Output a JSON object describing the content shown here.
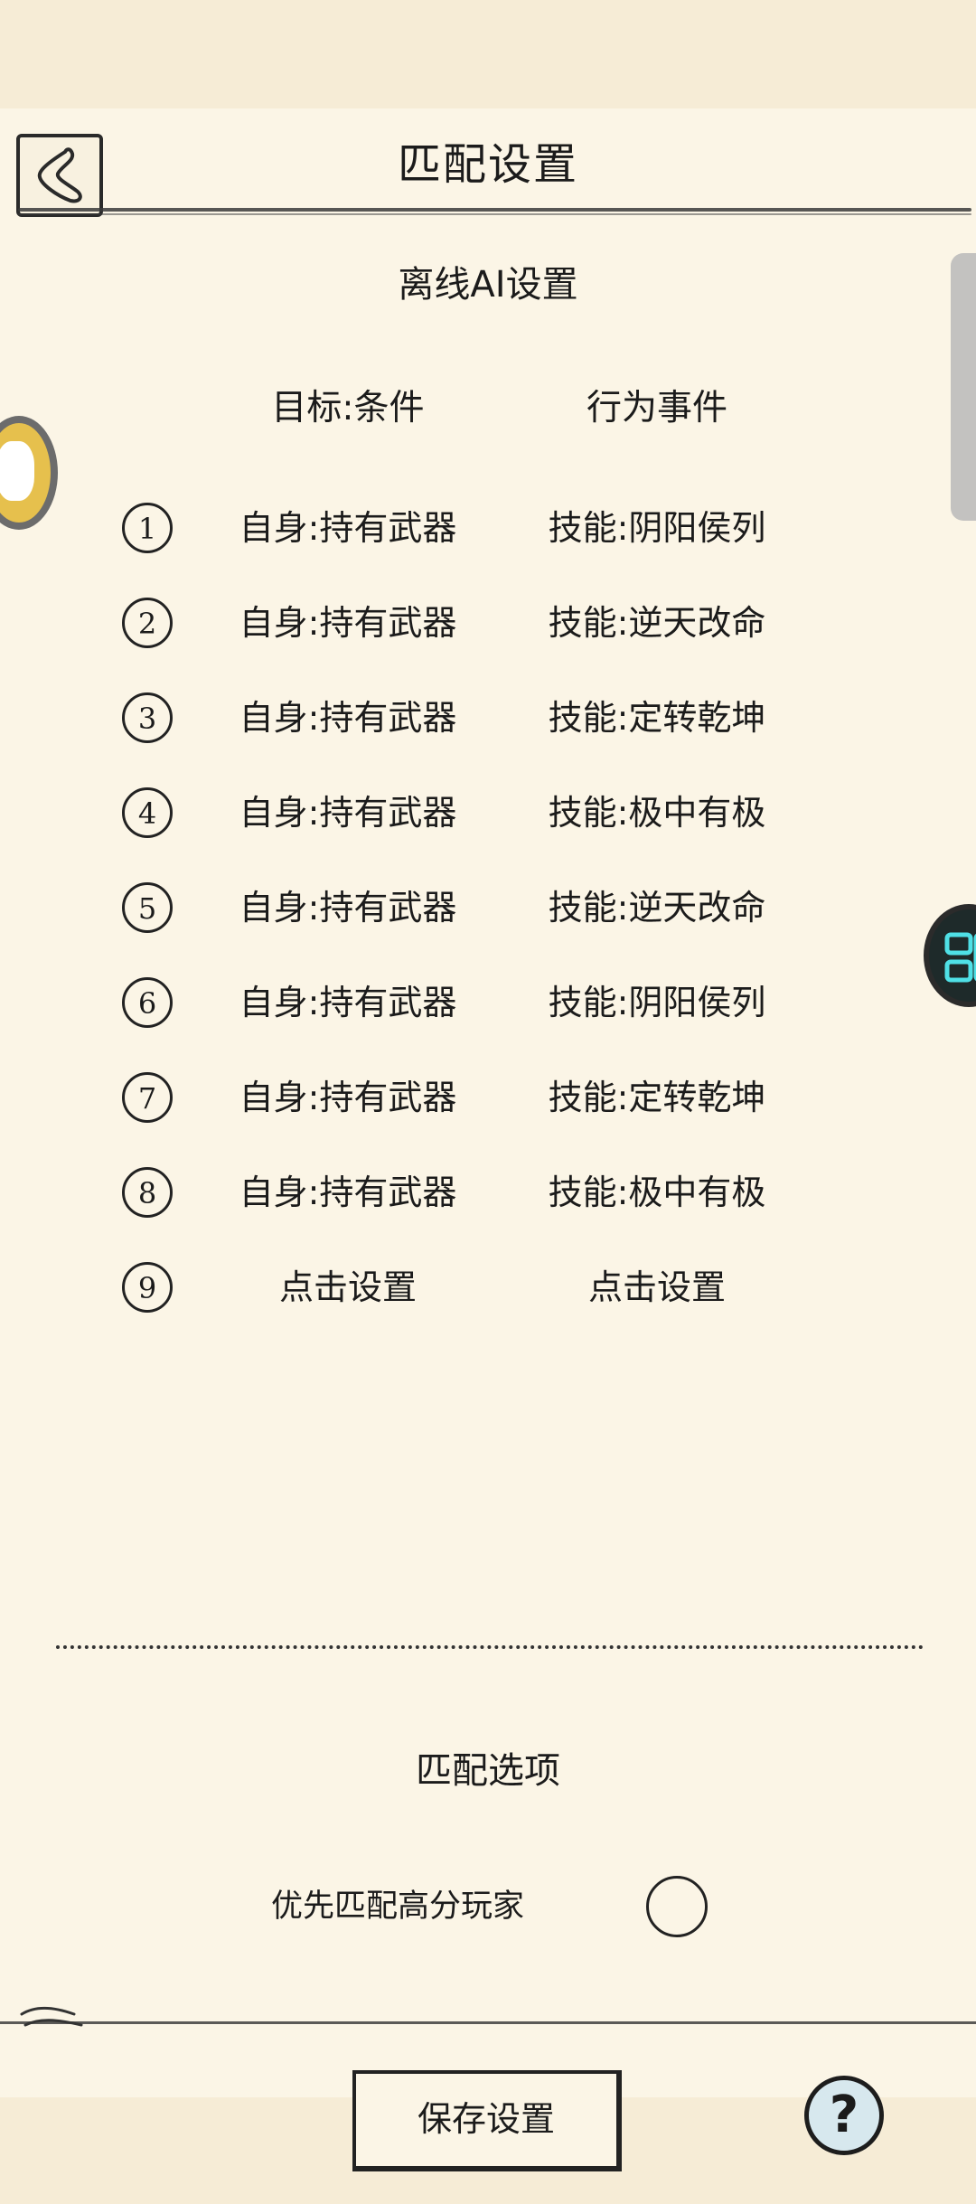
{
  "header": {
    "title": "匹配设置",
    "back_icon": "chevron-left-icon"
  },
  "ai_section": {
    "title": "离线AI设置",
    "col_condition": "目标:条件",
    "col_action": "行为事件",
    "rules": [
      {
        "num": "1",
        "condition": "自身:持有武器",
        "action": "技能:阴阳侯列"
      },
      {
        "num": "2",
        "condition": "自身:持有武器",
        "action": "技能:逆天改命"
      },
      {
        "num": "3",
        "condition": "自身:持有武器",
        "action": "技能:定转乾坤"
      },
      {
        "num": "4",
        "condition": "自身:持有武器",
        "action": "技能:极中有极"
      },
      {
        "num": "5",
        "condition": "自身:持有武器",
        "action": "技能:逆天改命"
      },
      {
        "num": "6",
        "condition": "自身:持有武器",
        "action": "技能:阴阳侯列"
      },
      {
        "num": "7",
        "condition": "自身:持有武器",
        "action": "技能:定转乾坤"
      },
      {
        "num": "8",
        "condition": "自身:持有武器",
        "action": "技能:极中有极"
      },
      {
        "num": "9",
        "condition": "点击设置",
        "action": "点击设置"
      }
    ]
  },
  "match_section": {
    "title": "匹配选项",
    "option_label": "优先匹配高分玩家",
    "option_checked": false
  },
  "footer": {
    "save_label": "保存设置",
    "help_label": "?"
  },
  "colors": {
    "background": "#f8f1e0",
    "panel": "#fbf5e6",
    "ink": "#1b1b1b",
    "help_fill": "#d7e8ee"
  }
}
